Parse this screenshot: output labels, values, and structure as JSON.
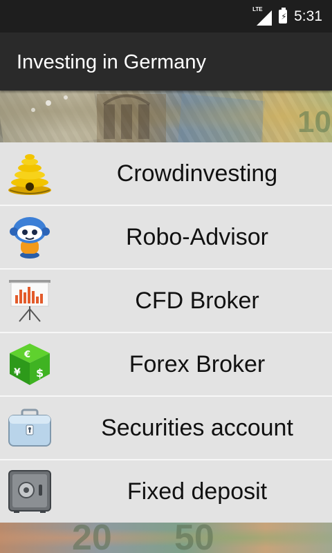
{
  "status_bar": {
    "network": "LTE",
    "time": "5:31"
  },
  "app_bar": {
    "title": "Investing in Germany"
  },
  "banner_bottom": {
    "note_values": [
      "20",
      "50"
    ]
  },
  "menu": {
    "items": [
      {
        "label": "Crowdinvesting",
        "icon": "beehive-icon"
      },
      {
        "label": "Robo-Advisor",
        "icon": "robot-icon"
      },
      {
        "label": "CFD Broker",
        "icon": "presentation-chart-icon"
      },
      {
        "label": "Forex Broker",
        "icon": "currency-dice-icon"
      },
      {
        "label": "Securities account",
        "icon": "briefcase-lock-icon"
      },
      {
        "label": "Fixed deposit",
        "icon": "safe-icon"
      }
    ]
  },
  "colors": {
    "status_bar": "#1e1e1e",
    "app_bar": "#2a2a2a",
    "menu_item_bg": "#e3e3e3",
    "menu_divider": "#f7f7f7"
  }
}
